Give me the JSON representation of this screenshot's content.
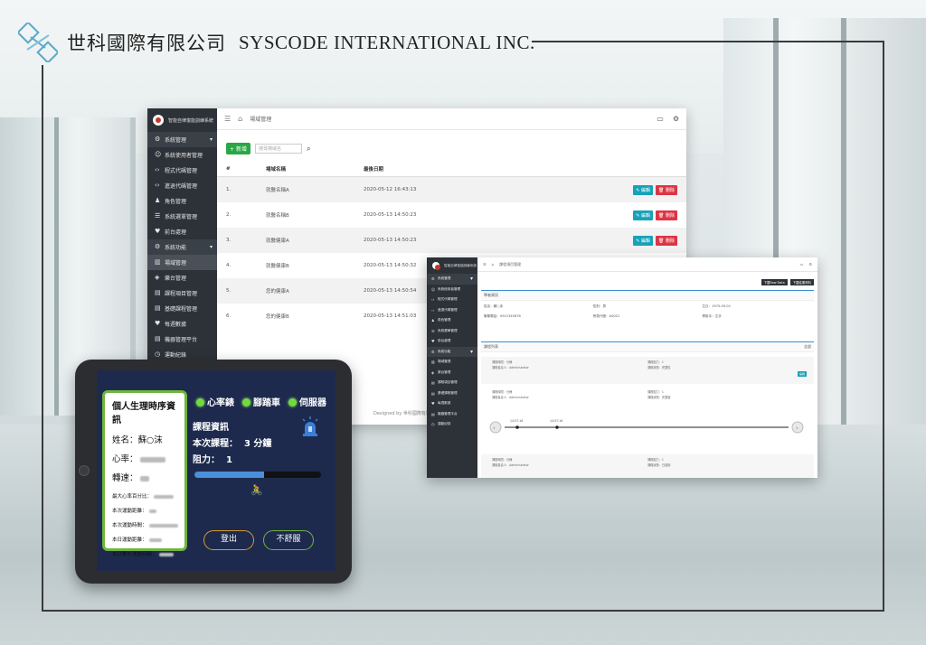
{
  "brand": {
    "name_cn": "世科國際有限公司",
    "name_en": "SYSCODE INTERNATIONAL INC."
  },
  "admin": {
    "app_title": "智能自律復能訓練系統",
    "breadcrumb": "場域管理",
    "add_label": "新增",
    "search_placeholder": "搜尋場域名",
    "sidebar": [
      {
        "label": "系統管理",
        "icon": "gear-icon",
        "group": true
      },
      {
        "label": "系統使用者管理",
        "icon": "user-icon"
      },
      {
        "label": "程式代碼管理",
        "icon": "code-icon"
      },
      {
        "label": "進退代碼管理",
        "icon": "code-icon"
      },
      {
        "label": "角色管理",
        "icon": "users-icon"
      },
      {
        "label": "系統選單管理",
        "icon": "list-icon"
      },
      {
        "label": "前台處理",
        "icon": "heart-icon"
      },
      {
        "label": "系統功能",
        "icon": "gear-icon",
        "group": true
      },
      {
        "label": "場域管理",
        "icon": "building-icon"
      },
      {
        "label": "樂台管理",
        "icon": "car-icon"
      },
      {
        "label": "課程項目管理",
        "icon": "doc-icon"
      },
      {
        "label": "基礎課程管理",
        "icon": "doc-icon"
      },
      {
        "label": "每週數據",
        "icon": "heart-icon"
      },
      {
        "label": "機器管理平台",
        "icon": "doc-icon"
      },
      {
        "label": "運動紀錄",
        "icon": "clock-icon"
      }
    ],
    "columns": [
      "#",
      "場域名稱",
      "最後日期"
    ],
    "rows": [
      {
        "num": "1.",
        "name": "就醫名稱A",
        "date": "2020-05-12 16:43:13"
      },
      {
        "num": "2.",
        "name": "就醫名稱B",
        "date": "2020-05-13 14:50:23"
      },
      {
        "num": "3.",
        "name": "就醫健康A",
        "date": "2020-05-13 14:50:23"
      },
      {
        "num": "4.",
        "name": "就醫健康B",
        "date": "2020-05-13 14:50:32"
      },
      {
        "num": "5.",
        "name": "您的健康A",
        "date": "2020-05-13 14:50:54"
      },
      {
        "num": "6.",
        "name": "您的健康B",
        "date": "2020-05-13 14:51:03"
      }
    ],
    "edit_label": "編輯",
    "delete_label": "刪除",
    "footer": "Designed by 世科國際有限公司"
  },
  "detail": {
    "breadcrumb": "課程項目管理",
    "download_raw": "下載Raw Data",
    "download_report": "下載結果資料",
    "section_basic": "學者資訊",
    "fields": [
      {
        "label": "姓名：",
        "value": "蘇○沫"
      },
      {
        "label": "性別：",
        "value": "男"
      },
      {
        "label": "生日：",
        "value": "1975-09-01"
      },
      {
        "label": "聯繫電話：",
        "value": "0912345678"
      },
      {
        "label": "會員代號：",
        "value": "A0001"
      },
      {
        "label": "慣用手：",
        "value": "左手"
      }
    ],
    "section_list": "課程列表",
    "show_all": "全部",
    "records": [
      {
        "a": "課程時間：分鐘",
        "b": "課程負責人：Administrator",
        "c": "課程阻力：1",
        "d": "課程狀態：完整性"
      },
      {
        "a": "課程時間：分鐘",
        "b": "課程負責人：Administrator",
        "c": "課程阻力：1",
        "d": "課程狀態：完整度"
      },
      {
        "a": "課程時間：分鐘",
        "b": "課程負責人：Administrator",
        "c": "課程阻力：1",
        "d": "課程狀態：已啟用"
      }
    ],
    "timeline_labels": [
      "14:57:16",
      "14:57:16"
    ]
  },
  "tablet": {
    "panel_title": "個人生理時序資訊",
    "name_label": "姓名：",
    "name_value": "蘇○沫",
    "hr_label": "心率：",
    "speed_label": "轉速：",
    "small_rows": [
      "最大心率百分比：",
      "本次運動距離：",
      "本次運動時間：",
      "本日運動距離：",
      "本日累計運動時間："
    ],
    "status_items": [
      "心率錶",
      "腳踏車",
      "伺服器"
    ],
    "course_title": "課程資訊",
    "course_duration_label": "本次課程：",
    "course_duration_value": "3 分鐘",
    "resistance_label": "阻力：",
    "resistance_value": "1",
    "progress": 0.55,
    "logout_label": "登出",
    "unwell_label": "不舒服"
  },
  "colors": {
    "accent_green": "#28a745",
    "accent_blue": "#17a2b8",
    "danger": "#dc3545",
    "sidebar": "#2d3238",
    "tablet_bg": "#1d2a4e"
  }
}
